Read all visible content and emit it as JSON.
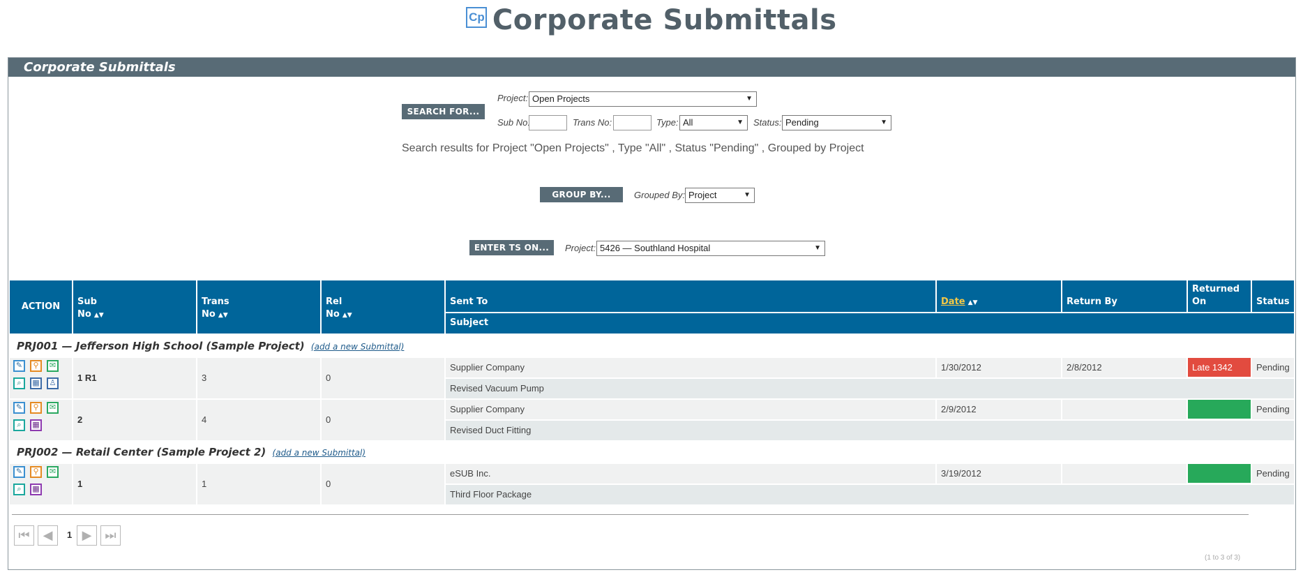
{
  "page": {
    "logo_text": "Cp",
    "title": "Corporate Submittals"
  },
  "panel": {
    "header": "Corporate Submittals"
  },
  "search": {
    "button": "SEARCH FOR...",
    "project_label": "Project:",
    "project_value": "Open Projects",
    "subno_label": "Sub No:",
    "subno_value": "",
    "transno_label": "Trans No:",
    "transno_value": "",
    "type_label": "Type:",
    "type_value": "All",
    "status_label": "Status:",
    "status_value": "Pending",
    "results_text": "Search results for Project \"Open Projects\" , Type \"All\" , Status  \"Pending\" , Grouped by Project"
  },
  "groupby": {
    "button": "GROUP BY...",
    "label": "Grouped By:",
    "value": "Project"
  },
  "enter_ts": {
    "button": "ENTER TS ON...",
    "label": "Project:",
    "value": "5426 — Southland Hospital"
  },
  "table": {
    "headers": {
      "action": "ACTION",
      "sub_no_1": "Sub",
      "sub_no_2": "No",
      "trans_no_1": "Trans",
      "trans_no_2": "No",
      "rel_no_1": "Rel",
      "rel_no_2": "No",
      "sent_to": "Sent To",
      "subject": "Subject",
      "date": "Date",
      "return_by": "Return By",
      "returned_on_1": "Returned",
      "returned_on_2": "On",
      "status": "Status"
    },
    "groups": [
      {
        "title": "PRJ001 — Jefferson High School (Sample Project)",
        "add_link": "(add a new Submittal)",
        "rows": [
          {
            "sub_no": "1 R1",
            "trans_no": "3",
            "rel_no": "0",
            "sent_to": "Supplier Company",
            "subject": "Revised Vacuum Pump",
            "date": "1/30/2012",
            "return_by": "2/8/2012",
            "returned_on": "Late 1342",
            "status": "Pending"
          },
          {
            "sub_no": "2",
            "trans_no": "4",
            "rel_no": "0",
            "sent_to": "Supplier Company",
            "subject": "Revised Duct Fitting",
            "date": "2/9/2012",
            "return_by": "",
            "returned_on": "",
            "status": "Pending"
          }
        ]
      },
      {
        "title": "PRJ002 — Retail Center (Sample Project 2)",
        "add_link": "(add a new Submittal)",
        "rows": [
          {
            "sub_no": "1",
            "trans_no": "1",
            "rel_no": "0",
            "sent_to": "eSUB Inc.",
            "subject": "Third Floor Package",
            "date": "3/19/2012",
            "return_by": "",
            "returned_on": "",
            "status": "Pending"
          }
        ]
      }
    ]
  },
  "pager": {
    "current_page": "1",
    "count_text": "(1 to 3 of 3)"
  },
  "colors": {
    "header_bar": "#586b76",
    "table_header": "#00659a",
    "late_badge": "#e24b3f",
    "ok_badge": "#27a95a"
  },
  "icons": [
    "edit-icon",
    "attachment-icon",
    "mail-icon",
    "search-icon",
    "calendar-icon",
    "contact-icon"
  ]
}
